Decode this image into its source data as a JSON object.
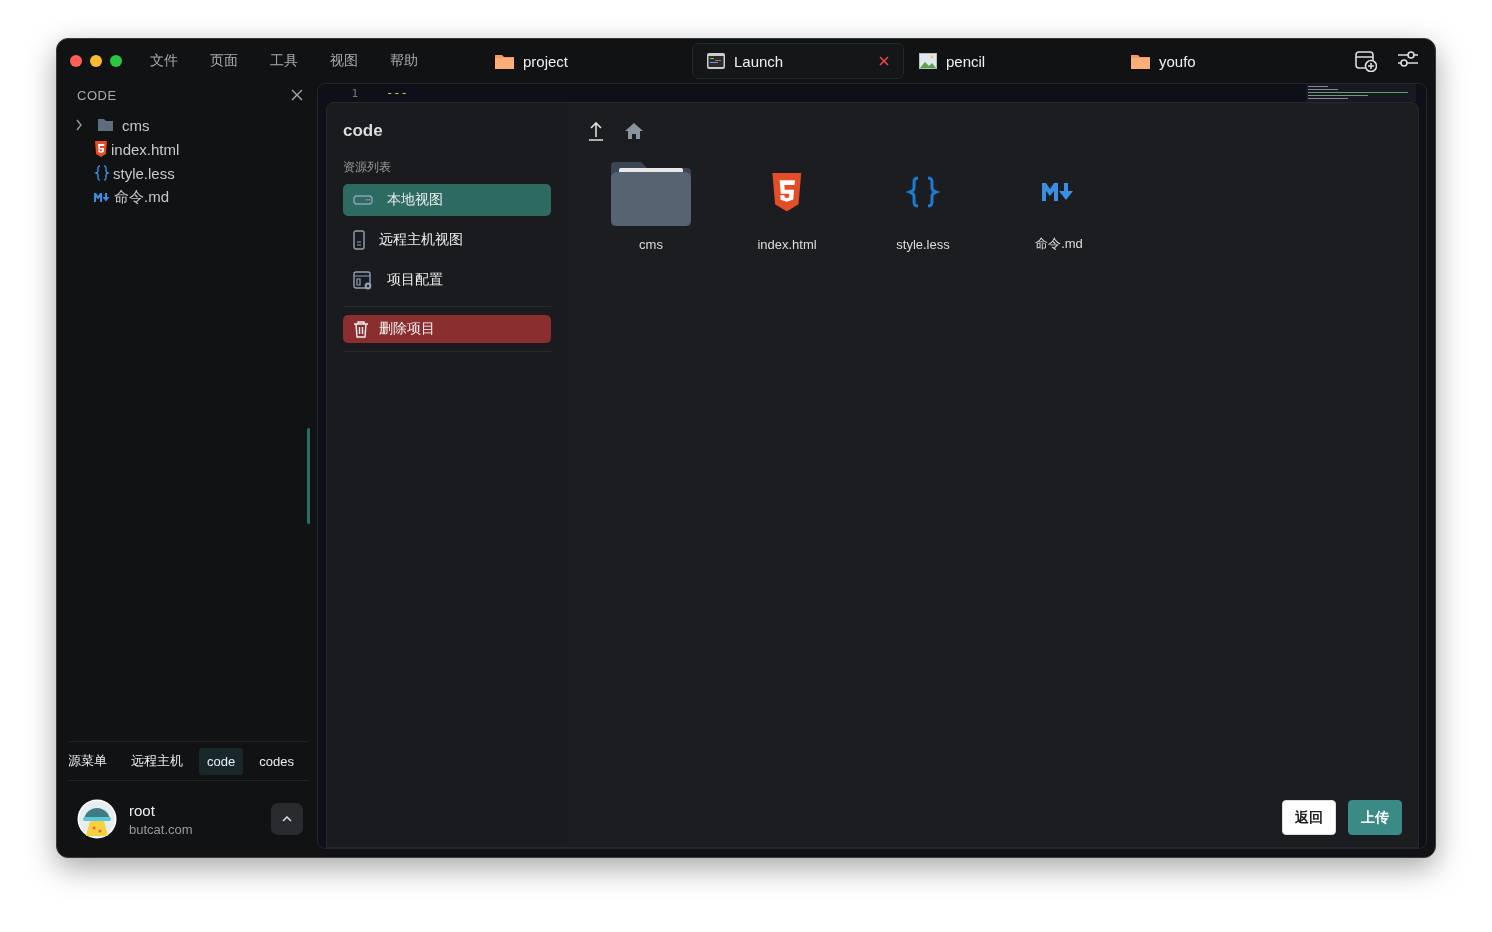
{
  "menu": [
    "文件",
    "页面",
    "工具",
    "视图",
    "帮助"
  ],
  "tabs": [
    {
      "label": "project",
      "kind": "folder",
      "selected": false,
      "closable": false
    },
    {
      "label": "Launch",
      "kind": "app",
      "selected": true,
      "closable": true
    },
    {
      "label": "pencil",
      "kind": "image",
      "selected": false,
      "closable": false
    },
    {
      "label": "youfo",
      "kind": "folder",
      "selected": false,
      "closable": false
    }
  ],
  "explorer": {
    "title": "CODE",
    "items": [
      {
        "name": "cms",
        "kind": "folder",
        "expanded": false
      },
      {
        "name": "index.html",
        "kind": "html"
      },
      {
        "name": "style.less",
        "kind": "less"
      },
      {
        "name": "命令.md",
        "kind": "md"
      }
    ]
  },
  "bottom_tabs": [
    {
      "label": "源菜单",
      "selected": false
    },
    {
      "label": "远程主机",
      "selected": false
    },
    {
      "label": "code",
      "selected": true
    },
    {
      "label": "codes",
      "selected": false
    }
  ],
  "user": {
    "name": "root",
    "host": "butcat.com"
  },
  "editor": {
    "line_number": "1",
    "line_text": "---"
  },
  "dialog": {
    "title": "code",
    "section": "资源列表",
    "nav": [
      {
        "label": "本地视图",
        "kind": "local",
        "selected": true
      },
      {
        "label": "远程主机视图",
        "kind": "remote",
        "selected": false
      },
      {
        "label": "项目配置",
        "kind": "config",
        "selected": false
      }
    ],
    "delete_button": "删除项目",
    "files": [
      {
        "name": "cms",
        "kind": "folder"
      },
      {
        "name": "index.html",
        "kind": "html"
      },
      {
        "name": "style.less",
        "kind": "less"
      },
      {
        "name": "命令.md",
        "kind": "md"
      }
    ],
    "buttons": [
      {
        "label": "返回",
        "kind": "secondary"
      },
      {
        "label": "上传",
        "kind": "primary"
      }
    ]
  }
}
